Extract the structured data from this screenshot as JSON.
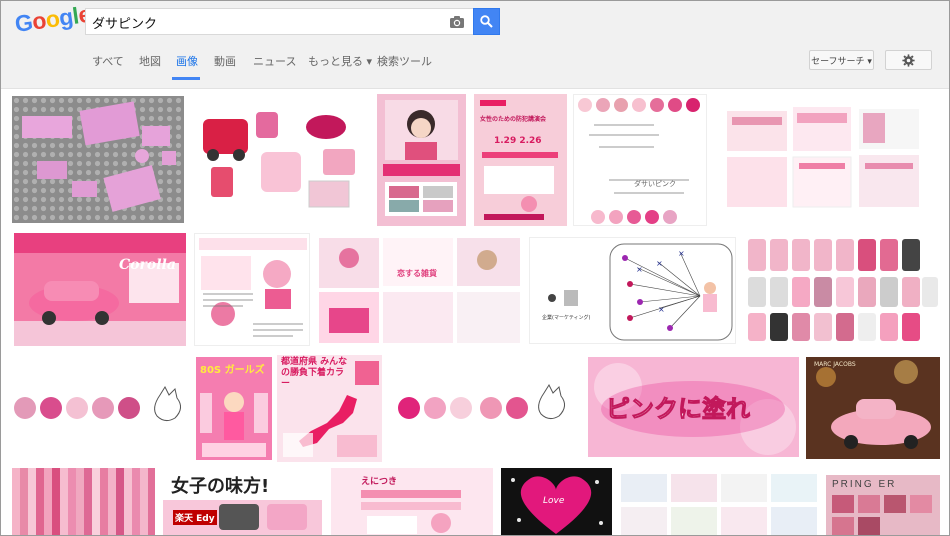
{
  "logo": {
    "letters": [
      "G",
      "o",
      "o",
      "g",
      "l",
      "e"
    ],
    "colors": [
      "#4285f4",
      "#ea4335",
      "#fbbc05",
      "#4285f4",
      "#34a853",
      "#ea4335"
    ]
  },
  "search": {
    "query": "ダサピンク"
  },
  "nav": {
    "tabs": [
      {
        "label": "すべて",
        "active": false
      },
      {
        "label": "地図",
        "active": false
      },
      {
        "label": "画像",
        "active": true
      },
      {
        "label": "動画",
        "active": false
      },
      {
        "label": "ニュース",
        "active": false
      },
      {
        "label": "もっと見る ▾",
        "active": false
      },
      {
        "label": "検索ツール",
        "active": false
      }
    ],
    "safe_search": "セーフサーチ ▾"
  },
  "images": {
    "r1": {
      "t4_poster": "女性のための防犯講演会",
      "t4_date": "1.29 2.26",
      "t5_text": "ダサいピンク"
    },
    "r2": {
      "t1_title": "Corolla",
      "t3_text": "恋する雑貨",
      "t4_label": "企業(マーケティング)"
    },
    "r3": {
      "t2_text": "80S ガールズ",
      "t3_text": "都道府県 みんなの勝負下着カラー",
      "t5_text": "ピンクに塗れ",
      "t6_text": "MARC JACOBS"
    },
    "r4": {
      "t2_text": "女子の味方!",
      "t2_sub": "楽天 Edy",
      "t3_text": "えにつき",
      "t4_text": "Love",
      "t6_text": "PRING ER"
    }
  },
  "colors": {
    "accent": "#4285f4",
    "pinks": [
      "#f0a0c4",
      "#e05a97",
      "#f4b6cf",
      "#e98fb5",
      "#d84f8a",
      "#f7c9d9",
      "#fbd8e4"
    ]
  }
}
